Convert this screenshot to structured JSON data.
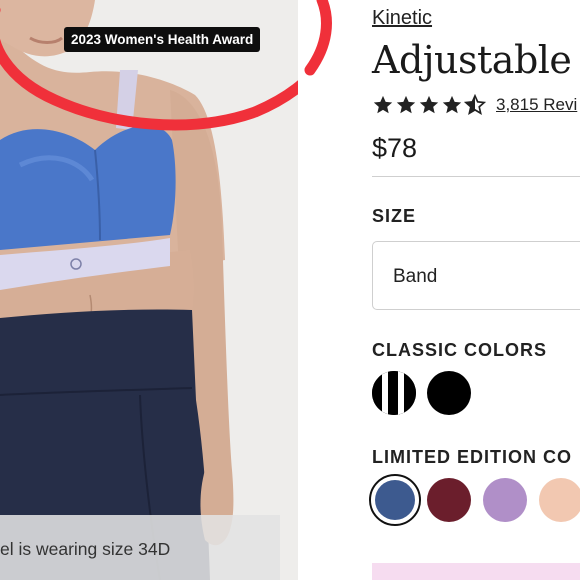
{
  "photo": {
    "award_badge": "2023 Women's Health Award",
    "caption": "el is wearing size 34D"
  },
  "product": {
    "brand": "Kinetic",
    "title": "Adjustable",
    "rating": 4.5,
    "reviews_label": "3,815 Revi",
    "price": "$78"
  },
  "size": {
    "label": "SIZE",
    "selected": "Band"
  },
  "classic_colors": {
    "label": "CLASSIC COLORS",
    "swatches": [
      {
        "name": "black-white-stripe",
        "color": "#000000"
      },
      {
        "name": "black",
        "color": "#000000"
      }
    ]
  },
  "limited_colors": {
    "label": "LIMITED EDITION CO",
    "swatches": [
      {
        "name": "navy",
        "color": "#3d5a8f",
        "selected": true
      },
      {
        "name": "burgundy",
        "color": "#6b1e2c"
      },
      {
        "name": "lilac",
        "color": "#b08fc8"
      },
      {
        "name": "blush",
        "color": "#f2c8b1"
      }
    ]
  },
  "colors": {
    "annotation_circle": "#f0303a",
    "bra_blue": "#4a77c9",
    "leggings_navy": "#262e48",
    "promo_pink": "#f6dcf0"
  }
}
